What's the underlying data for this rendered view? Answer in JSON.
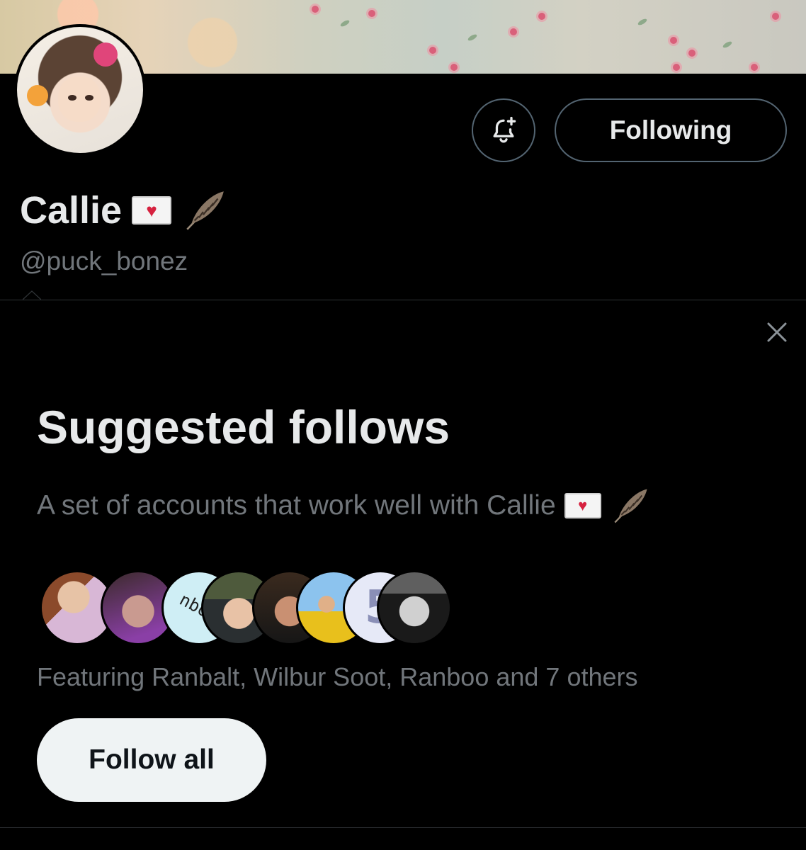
{
  "profile": {
    "name": "Callie",
    "handle": "@puck_bonez",
    "name_emojis": [
      "envelope-with-heart",
      "feather"
    ]
  },
  "actions": {
    "notify_icon": "bell-plus-icon",
    "following_label": "Following"
  },
  "suggested": {
    "title": "Suggested follows",
    "subtitle": "A set of accounts that work well with Callie",
    "featuring": "Featuring Ranbalt, Wilbur Soot, Ranboo and 7 others",
    "follow_all_label": "Follow all",
    "avatar_count": 8,
    "avatar_text_3": "nboo",
    "avatar_text_7": "5"
  },
  "colors": {
    "background": "#000000",
    "primary_text": "#e7e9ea",
    "secondary_text": "#71767b",
    "border": "#536471",
    "button_light": "#eff3f4"
  }
}
